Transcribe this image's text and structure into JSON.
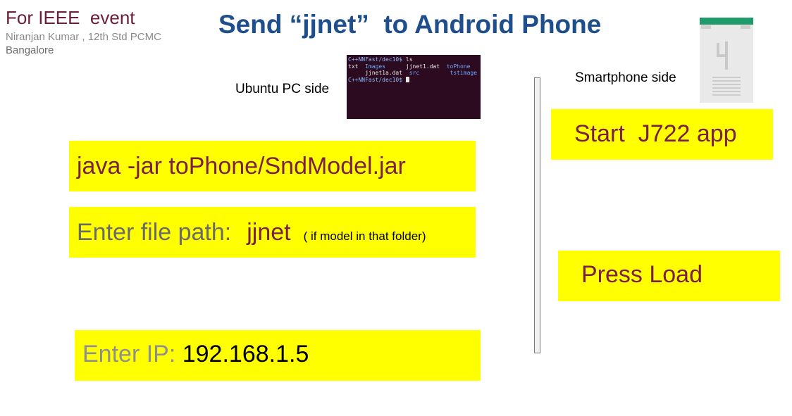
{
  "header": {
    "event": "For IEEE  event",
    "author": "Niranjan Kumar , 12th Std PCMC",
    "city": "Bangalore",
    "title": "Send “jjnet”  to Android Phone"
  },
  "labels": {
    "pc_side": "Ubuntu PC side",
    "phone_side": "Smartphone side"
  },
  "terminal": {
    "prompt1": "C++NNFast/dec10$ ",
    "command": "ls",
    "row1_c1": "txt  ",
    "row1_c2": "Images",
    "row1_c3": "      jjnet1.dat  ",
    "row1_c4": "toPhone",
    "row2_c1": "     jjnet1a.dat  ",
    "row2_c2": "src",
    "row2_c3": "         ",
    "row2_c4": "tstimage",
    "prompt2": "C++NNFast/dec10$ "
  },
  "pc_steps": {
    "java_command": "java -jar toPhone/SndModel.jar",
    "path_label": "Enter file path:",
    "path_value": "jjnet",
    "path_note": "( if model in that folder)",
    "ip_label": "Enter IP: ",
    "ip_value": "192.168.1.5"
  },
  "phone_steps": {
    "start": "Start  J722 app",
    "load": "Press Load"
  },
  "colors": {
    "title": "#1f4e8c",
    "accent_maroon": "#7a1f4a",
    "highlight": "#ffff00",
    "terminal_bg": "#2c0a1f"
  }
}
